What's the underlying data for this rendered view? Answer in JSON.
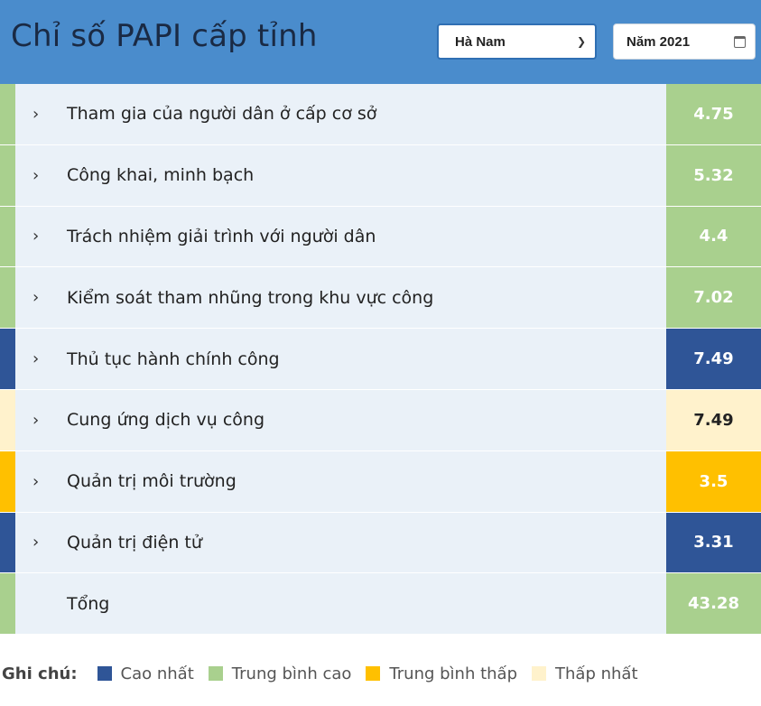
{
  "header": {
    "title": "Chỉ số PAPI cấp tỉnh",
    "province": "Hà Nam",
    "year": "Năm 2021"
  },
  "colors": {
    "header_bg": "#4a8ccc",
    "cao_nhat": "#2f5597",
    "trung_binh_cao": "#a9d08e",
    "trung_binh_thap": "#ffc000",
    "thap_nhat": "#fff2cc"
  },
  "rows": [
    {
      "label": "Tham gia của người dân ở cấp cơ sở",
      "value": "4.75",
      "level": "trung_binh_cao",
      "expandable": true
    },
    {
      "label": "Công khai, minh bạch",
      "value": "5.32",
      "level": "trung_binh_cao",
      "expandable": true
    },
    {
      "label": "Trách nhiệm giải trình với người dân",
      "value": "4.4",
      "level": "trung_binh_cao",
      "expandable": true
    },
    {
      "label": "Kiểm soát tham nhũng trong khu vực công",
      "value": "7.02",
      "level": "trung_binh_cao",
      "expandable": true
    },
    {
      "label": "Thủ tục hành chính công",
      "value": "7.49",
      "level": "cao_nhat",
      "expandable": true
    },
    {
      "label": "Cung ứng dịch vụ công",
      "value": "7.49",
      "level": "thap_nhat",
      "expandable": true
    },
    {
      "label": "Quản trị môi trường",
      "value": "3.5",
      "level": "trung_binh_thap",
      "expandable": true
    },
    {
      "label": "Quản trị điện tử",
      "value": "3.31",
      "level": "cao_nhat",
      "expandable": true
    },
    {
      "label": "Tổng",
      "value": "43.28",
      "level": "trung_binh_cao",
      "expandable": false
    }
  ],
  "legend": {
    "title": "Ghi chú:",
    "items": [
      {
        "label": "Cao nhất",
        "level": "cao_nhat"
      },
      {
        "label": "Trung bình cao",
        "level": "trung_binh_cao"
      },
      {
        "label": "Trung bình thấp",
        "level": "trung_binh_thap"
      },
      {
        "label": "Thấp nhất",
        "level": "thap_nhat"
      }
    ]
  }
}
